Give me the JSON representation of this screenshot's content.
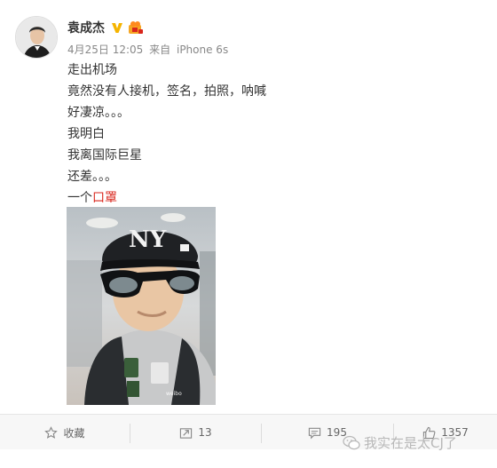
{
  "user": {
    "name": "袁成杰",
    "time": "4月25日 12:05",
    "source_prefix": "来自",
    "source": "iPhone 6s"
  },
  "post": {
    "lines": [
      "走出机场",
      "竟然没有人接机，签名，拍照，呐喊",
      "好凄凉。。。",
      "我明白",
      "我离国际巨星",
      "还差。。。"
    ],
    "last_line_prefix": "一个",
    "last_line_link": "口罩"
  },
  "photo": {
    "watermark": "@袁成杰"
  },
  "toolbar": {
    "favorite_label": "收藏",
    "repost_count": "13",
    "comment_count": "195",
    "like_count": "1357"
  },
  "overlay": {
    "watermark_text": "我实在是太CJ了"
  },
  "colors": {
    "link": "#d9261c",
    "verified": "#f5b400"
  }
}
